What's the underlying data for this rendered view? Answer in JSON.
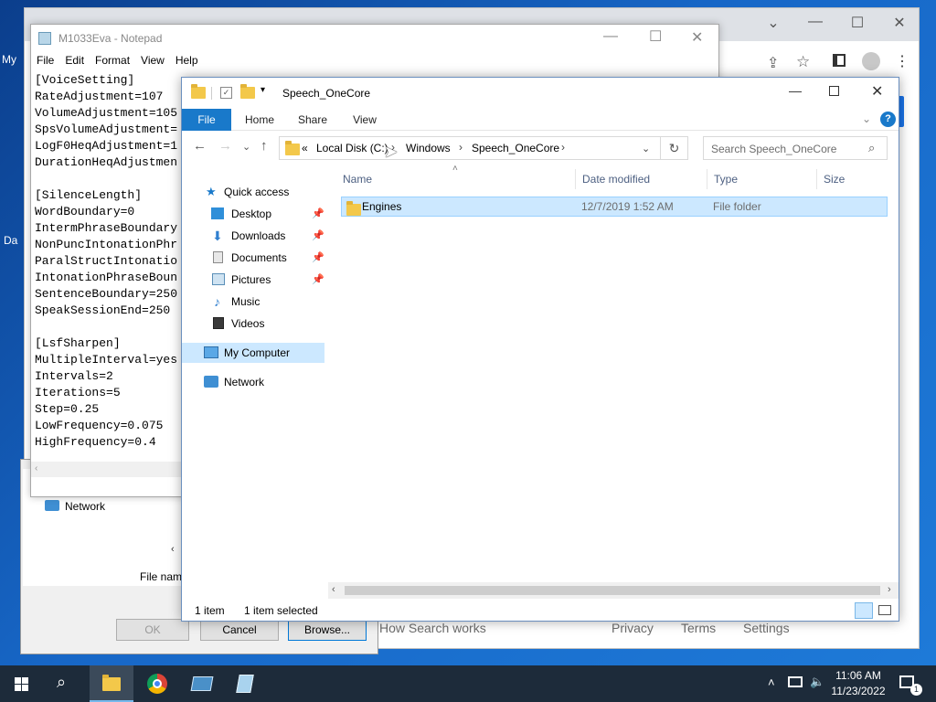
{
  "desktop": {
    "icon_label_1": "My",
    "icon_label_2": "Da"
  },
  "browser": {
    "footer_left": "How Search works",
    "footer_links": [
      "Privacy",
      "Terms",
      "Settings"
    ]
  },
  "dialog": {
    "nav_network": "Network",
    "file_name_label": "File nam",
    "ok": "OK",
    "cancel": "Cancel",
    "browse": "Browse..."
  },
  "notepad": {
    "title": "M1033Eva - Notepad",
    "menu": [
      "File",
      "Edit",
      "Format",
      "View",
      "Help"
    ],
    "lines": [
      "[VoiceSetting]",
      "RateAdjustment=107",
      "VolumeAdjustment=105",
      "SpsVolumeAdjustment=",
      "LogF0HeqAdjustment=1",
      "DurationHeqAdjustmen",
      "",
      "[SilenceLength]",
      "WordBoundary=0",
      "IntermPhraseBoundary",
      "NonPuncIntonationPhr",
      "ParalStructIntonatio",
      "IntonationPhraseBoun",
      "SentenceBoundary=250",
      "SpeakSessionEnd=250",
      "",
      "[LsfSharpen]",
      "MultipleInterval=yes",
      "Intervals=2",
      "Iterations=5",
      "Step=0.25",
      "LowFrequency=0.075",
      "HighFrequency=0.4"
    ]
  },
  "explorer": {
    "title": "Speech_OneCore",
    "ribbon_tabs": [
      "File",
      "Home",
      "Share",
      "View"
    ],
    "breadcrumb": {
      "overflow": "«",
      "items": [
        "Local Disk (C:)",
        "Windows",
        "Speech_OneCore"
      ]
    },
    "search_placeholder": "Search Speech_OneCore",
    "nav": {
      "quick_access": "Quick access",
      "desktop": "Desktop",
      "downloads": "Downloads",
      "documents": "Documents",
      "pictures": "Pictures",
      "music": "Music",
      "videos": "Videos",
      "my_computer": "My Computer",
      "network": "Network"
    },
    "columns": [
      "Name",
      "Date modified",
      "Type",
      "Size"
    ],
    "rows": [
      {
        "name": "Engines",
        "date": "12/7/2019 1:52 AM",
        "type": "File folder",
        "size": ""
      }
    ],
    "status": {
      "count": "1 item",
      "selected": "1 item selected"
    }
  },
  "taskbar": {
    "time": "11:06 AM",
    "date": "11/23/2022",
    "notification_count": "1"
  }
}
